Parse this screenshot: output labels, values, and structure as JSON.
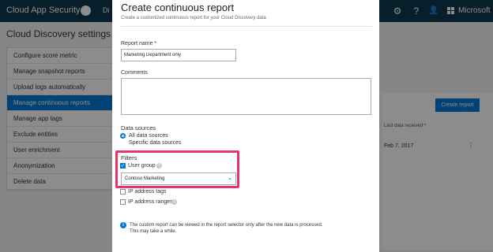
{
  "topbar": {
    "app_title": "Cloud App Security",
    "nav_partial": "Di",
    "settings_glyph": "⚙",
    "help_glyph": "?",
    "user_glyph": "👤",
    "brand": "Microsoft"
  },
  "settings": {
    "title": "Cloud Discovery settings",
    "items": [
      {
        "label": "Configure score metric"
      },
      {
        "label": "Manage snapshot reports"
      },
      {
        "label": "Upload logs automatically"
      },
      {
        "label": "Manage continuous reports"
      },
      {
        "label": "Manage app tags"
      },
      {
        "label": "Exclude entities"
      },
      {
        "label": "User enrichment"
      },
      {
        "label": "Anonymization"
      },
      {
        "label": "Delete data"
      }
    ],
    "active_index": 3
  },
  "background_table": {
    "create_button": "Create report",
    "column_last_received": "Last data received ^",
    "row_date": "Feb 7, 2017",
    "row_more": "⋮"
  },
  "modal": {
    "title": "Create continuous report",
    "subtitle": "Create a customized continuous report for your Cloud Discovery data",
    "report_name_label": "Report name",
    "report_name_required": "*",
    "report_name_value": "Marketing Department only",
    "comments_label": "Comments",
    "comments_value": "",
    "data_sources_label": "Data sources",
    "data_sources_options": [
      {
        "label": "All data sources",
        "checked": true
      },
      {
        "label": "Specific data sources",
        "checked": false
      }
    ],
    "filters_label": "Filters",
    "filter_user_group": {
      "label": "User group",
      "checked": true
    },
    "user_group_selected": "Contoso Marketing",
    "filter_ip_tags": {
      "label": "IP address tags",
      "checked": false
    },
    "filter_ip_ranges": {
      "label": "IP address ranges",
      "checked": false
    },
    "note_line1": "The custom report can be viewed in the report selector only after the new data is processed.",
    "note_line2": "This may take a while.",
    "info_glyph": "i"
  },
  "colors": {
    "topbar": "#0d3a4e",
    "accent": "#0078d4",
    "highlight": "#e8336b"
  }
}
